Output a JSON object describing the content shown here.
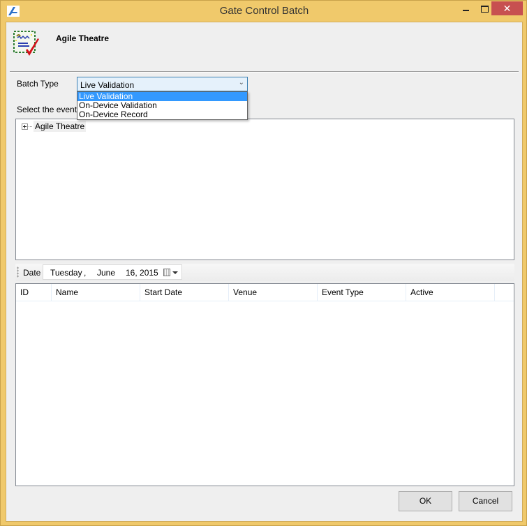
{
  "window": {
    "title": "Gate Control Batch",
    "colors": {
      "frame": "#f0c96b",
      "close": "#c75050",
      "selection": "#3399ff"
    },
    "controls": [
      "minimize-icon",
      "maximize-icon",
      "close-icon"
    ],
    "close_glyph": "✕"
  },
  "header": {
    "title": "Agile Theatre",
    "icon": "batch-validation-icon"
  },
  "batch_type": {
    "label": "Batch Type",
    "selected": "Live Validation",
    "arrow": "⌄",
    "options": [
      "Live Validation",
      "On-Device Validation",
      "On-Device Record"
    ]
  },
  "events": {
    "label": "Select the events",
    "tree": [
      {
        "label": "Agile Theatre",
        "expanded": false
      }
    ]
  },
  "date": {
    "label": "Date",
    "day_of_week": "Tuesday",
    "separator": ",",
    "month": "June",
    "day_year": "16, 2015"
  },
  "grid": {
    "columns": [
      "ID",
      "Name",
      "Start Date",
      "Venue",
      "Event Type",
      "Active"
    ],
    "rows": []
  },
  "buttons": {
    "ok": "OK",
    "cancel": "Cancel"
  }
}
